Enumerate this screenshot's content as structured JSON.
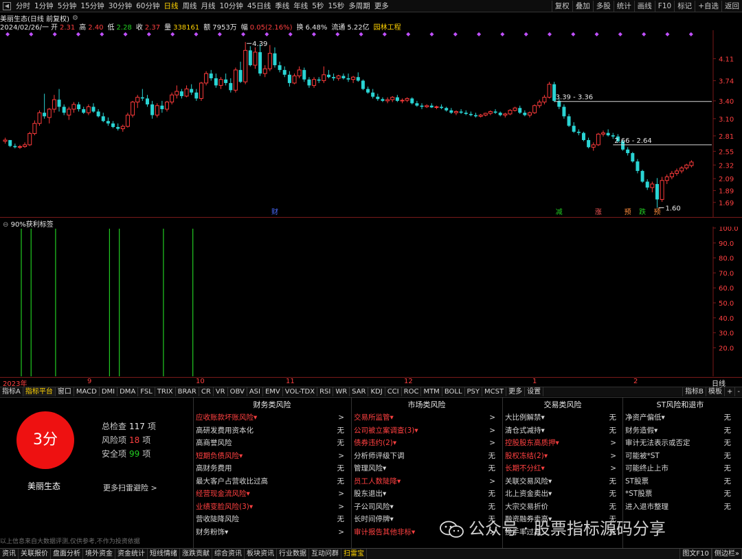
{
  "toolbar": {
    "periods": [
      "分时",
      "1分钟",
      "5分钟",
      "15分钟",
      "30分钟",
      "60分钟",
      "日线",
      "周线",
      "月线",
      "10分钟",
      "45日线",
      "季线",
      "年线",
      "5秒",
      "15秒",
      "多周期",
      "更多"
    ],
    "active_period": "日线",
    "right_buttons": [
      "复权",
      "叠加",
      "多股",
      "统计",
      "画线",
      "F10",
      "标记",
      "+自选",
      "返回"
    ]
  },
  "title": {
    "stock": "美丽生态(日线 前复权)",
    "date": "2024/02/26/一",
    "open_label": "开",
    "open": "2.31",
    "high_label": "高",
    "high": "2.40",
    "low_label": "低",
    "low": "2.28",
    "close_label": "收",
    "close": "2.37",
    "vol_label": "量",
    "volume": "338161",
    "amt_label": "额",
    "amount": "7953万",
    "chg_label": "幅",
    "change": "0.05(2.16%)",
    "turn_label": "换",
    "turnover": "6.48%",
    "float_label": "流通",
    "float_cap": "5.22亿",
    "sector": "园林工程"
  },
  "chart_data": {
    "type": "candlestick",
    "price_axis_ticks": [
      "4.11",
      "3.74",
      "3.40",
      "3.10",
      "2.81",
      "2.55",
      "2.32",
      "2.09",
      "1.89",
      "1.69"
    ],
    "ylim": [
      1.56,
      4.52
    ],
    "annotations": {
      "high_label": "4.39",
      "low_label": "1.60",
      "resistance_1": "3.39 - 3.36",
      "resistance_2": "2.66 - 2.64",
      "markers": [
        "财",
        "减",
        "涨",
        "预",
        "跌",
        "预"
      ]
    },
    "candles": [
      [
        2.72,
        2.78,
        2.68,
        2.74
      ],
      [
        2.74,
        2.74,
        2.62,
        2.64
      ],
      [
        2.64,
        2.68,
        2.6,
        2.62
      ],
      [
        2.63,
        2.66,
        2.59,
        2.63
      ],
      [
        2.63,
        2.7,
        2.61,
        2.66
      ],
      [
        2.66,
        2.88,
        2.64,
        2.85
      ],
      [
        2.85,
        3.07,
        2.82,
        3.02
      ],
      [
        3.02,
        3.24,
        2.98,
        3.2
      ],
      [
        3.2,
        3.52,
        3.1,
        3.14
      ],
      [
        3.12,
        3.28,
        3.02,
        3.26
      ],
      [
        3.26,
        3.5,
        3.2,
        3.42
      ],
      [
        3.42,
        3.6,
        3.22,
        3.3
      ],
      [
        3.3,
        3.34,
        3.16,
        3.2
      ],
      [
        3.16,
        3.3,
        3.08,
        3.26
      ],
      [
        3.26,
        3.38,
        3.2,
        3.34
      ],
      [
        3.34,
        3.38,
        3.22,
        3.26
      ],
      [
        3.26,
        3.3,
        3.18,
        3.2
      ],
      [
        3.2,
        3.34,
        3.16,
        3.3
      ],
      [
        3.3,
        3.36,
        3.2,
        3.22
      ],
      [
        3.22,
        3.26,
        3.12,
        3.14
      ],
      [
        3.14,
        3.2,
        3.04,
        3.06
      ],
      [
        3.06,
        3.12,
        2.98,
        3.02
      ],
      [
        3.02,
        3.06,
        2.94,
        2.96
      ],
      [
        2.96,
        3.02,
        2.9,
        2.93
      ],
      [
        2.93,
        3.0,
        2.88,
        2.97
      ],
      [
        2.97,
        3.2,
        2.95,
        3.16
      ],
      [
        3.16,
        3.4,
        3.12,
        3.38
      ],
      [
        3.38,
        3.5,
        3.28,
        3.46
      ],
      [
        3.46,
        3.6,
        3.4,
        3.44
      ],
      [
        3.44,
        3.5,
        3.3,
        3.34
      ],
      [
        3.34,
        3.4,
        3.1,
        3.16
      ],
      [
        3.16,
        3.36,
        3.12,
        3.32
      ],
      [
        3.32,
        3.4,
        3.2,
        3.26
      ],
      [
        3.26,
        3.4,
        3.22,
        3.38
      ],
      [
        3.38,
        3.54,
        3.34,
        3.5
      ],
      [
        3.5,
        3.66,
        3.44,
        3.56
      ],
      [
        3.56,
        3.6,
        3.44,
        3.48
      ],
      [
        3.48,
        3.66,
        3.46,
        3.6
      ],
      [
        3.6,
        3.68,
        3.5,
        3.54
      ],
      [
        3.54,
        3.6,
        3.4,
        3.44
      ],
      [
        3.44,
        3.72,
        3.4,
        3.7
      ],
      [
        3.7,
        3.9,
        3.66,
        3.86
      ],
      [
        3.86,
        3.92,
        3.74,
        3.78
      ],
      [
        3.78,
        3.86,
        3.62,
        3.66
      ],
      [
        3.66,
        3.8,
        3.6,
        3.76
      ],
      [
        3.76,
        3.86,
        3.66,
        3.7
      ],
      [
        3.7,
        3.78,
        3.54,
        3.58
      ],
      [
        3.58,
        3.96,
        3.54,
        3.92
      ],
      [
        3.92,
        4.06,
        3.7,
        3.72
      ],
      [
        3.72,
        4.39,
        3.68,
        4.25
      ],
      [
        4.25,
        4.32,
        3.98,
        4.0
      ],
      [
        4.0,
        4.3,
        3.94,
        4.22
      ],
      [
        4.22,
        4.36,
        3.82,
        3.86
      ],
      [
        3.86,
        4.0,
        3.8,
        3.94
      ],
      [
        3.94,
        4.34,
        3.9,
        4.2
      ],
      [
        4.2,
        4.3,
        3.96,
        4.0
      ],
      [
        4.0,
        4.06,
        3.88,
        3.92
      ],
      [
        3.92,
        3.98,
        3.8,
        3.84
      ],
      [
        3.84,
        3.9,
        3.64,
        3.7
      ],
      [
        3.7,
        3.86,
        3.68,
        3.82
      ],
      [
        3.82,
        3.98,
        3.78,
        3.92
      ],
      [
        3.92,
        3.96,
        3.72,
        3.76
      ],
      [
        3.76,
        3.8,
        3.62,
        3.66
      ],
      [
        3.66,
        3.8,
        3.62,
        3.76
      ],
      [
        3.76,
        3.8,
        3.7,
        3.74
      ],
      [
        3.74,
        3.98,
        3.7,
        3.84
      ],
      [
        3.84,
        3.92,
        3.78,
        3.8
      ],
      [
        3.8,
        3.86,
        3.74,
        3.78
      ],
      [
        3.78,
        3.84,
        3.74,
        3.82
      ],
      [
        3.82,
        3.86,
        3.76,
        3.78
      ],
      [
        3.78,
        3.86,
        3.72,
        3.76
      ],
      [
        3.76,
        3.82,
        3.7,
        3.8
      ],
      [
        3.8,
        3.88,
        3.72,
        3.74
      ],
      [
        3.74,
        3.76,
        3.58,
        3.6
      ],
      [
        3.6,
        3.64,
        3.52,
        3.54
      ],
      [
        3.54,
        3.6,
        3.44,
        3.47
      ],
      [
        3.47,
        3.52,
        3.4,
        3.43
      ],
      [
        3.43,
        3.46,
        3.38,
        3.4
      ],
      [
        3.4,
        3.46,
        3.36,
        3.42
      ],
      [
        3.42,
        3.48,
        3.38,
        3.46
      ],
      [
        3.46,
        3.5,
        3.38,
        3.4
      ],
      [
        3.4,
        3.44,
        3.36,
        3.41
      ],
      [
        3.41,
        3.46,
        3.38,
        3.44
      ],
      [
        3.44,
        3.46,
        3.34,
        3.36
      ],
      [
        3.36,
        3.4,
        3.3,
        3.32
      ],
      [
        3.32,
        3.36,
        3.26,
        3.3
      ],
      [
        3.3,
        3.34,
        3.28,
        3.32
      ],
      [
        3.32,
        3.36,
        3.28,
        3.29
      ],
      [
        3.29,
        3.32,
        3.26,
        3.3
      ],
      [
        3.3,
        3.34,
        3.26,
        3.28
      ],
      [
        3.28,
        3.3,
        3.22,
        3.24
      ],
      [
        3.24,
        3.28,
        3.18,
        3.2
      ],
      [
        3.2,
        3.24,
        3.16,
        3.22
      ],
      [
        3.22,
        3.26,
        3.18,
        3.2
      ],
      [
        3.2,
        3.24,
        3.16,
        3.18
      ],
      [
        3.18,
        3.22,
        3.14,
        3.16
      ],
      [
        3.16,
        3.2,
        3.12,
        3.14
      ],
      [
        3.14,
        3.18,
        3.12,
        3.16
      ],
      [
        3.16,
        3.2,
        3.14,
        3.19
      ],
      [
        3.19,
        3.24,
        3.16,
        3.22
      ],
      [
        3.22,
        3.26,
        3.18,
        3.2
      ],
      [
        3.2,
        3.22,
        3.14,
        3.16
      ],
      [
        3.16,
        3.2,
        3.12,
        3.18
      ],
      [
        3.18,
        3.26,
        3.16,
        3.24
      ],
      [
        3.24,
        3.3,
        3.22,
        3.28
      ],
      [
        3.28,
        3.32,
        3.18,
        3.2
      ],
      [
        3.2,
        3.24,
        3.14,
        3.16
      ],
      [
        3.16,
        3.22,
        3.12,
        3.2
      ],
      [
        3.2,
        3.34,
        3.18,
        3.32
      ],
      [
        3.32,
        3.42,
        3.28,
        3.38
      ],
      [
        3.38,
        3.5,
        3.34,
        3.46
      ],
      [
        3.46,
        3.72,
        3.44,
        3.68
      ],
      [
        3.68,
        3.72,
        3.38,
        3.4
      ],
      [
        3.4,
        3.44,
        3.26,
        3.3
      ],
      [
        3.3,
        3.34,
        3.1,
        3.14
      ],
      [
        3.14,
        3.18,
        2.96,
        2.98
      ],
      [
        2.98,
        3.04,
        2.86,
        2.88
      ],
      [
        2.88,
        2.92,
        2.82,
        2.86
      ],
      [
        2.86,
        2.88,
        2.72,
        2.74
      ],
      [
        2.74,
        2.78,
        2.6,
        2.62
      ],
      [
        2.62,
        2.7,
        2.56,
        2.66
      ],
      [
        2.66,
        2.86,
        2.64,
        2.84
      ],
      [
        2.84,
        2.9,
        2.8,
        2.86
      ],
      [
        2.86,
        2.92,
        2.8,
        2.82
      ],
      [
        2.82,
        2.86,
        2.76,
        2.8
      ],
      [
        2.8,
        2.84,
        2.7,
        2.72
      ],
      [
        2.72,
        2.74,
        2.56,
        2.58
      ],
      [
        2.58,
        2.62,
        2.48,
        2.52
      ],
      [
        2.52,
        2.54,
        2.36,
        2.38
      ],
      [
        2.38,
        2.42,
        2.18,
        2.22
      ],
      [
        2.22,
        2.24,
        2.02,
        2.04
      ],
      [
        2.04,
        2.08,
        1.9,
        1.94
      ],
      [
        1.94,
        2.04,
        1.86,
        2.0
      ],
      [
        2.0,
        2.1,
        1.6,
        1.74
      ],
      [
        1.74,
        2.12,
        1.7,
        2.06
      ],
      [
        2.06,
        2.16,
        2.0,
        2.12
      ],
      [
        2.12,
        2.22,
        2.08,
        2.18
      ],
      [
        2.18,
        2.26,
        2.14,
        2.22
      ],
      [
        2.22,
        2.3,
        2.18,
        2.27
      ],
      [
        2.27,
        2.34,
        2.24,
        2.32
      ],
      [
        2.31,
        2.4,
        2.28,
        2.37
      ]
    ],
    "subchart": {
      "title": "90%获利标签",
      "axis_ticks": [
        "100.0",
        "90.0",
        "80.0",
        "70.0",
        "60.0",
        "50.0",
        "40.0",
        "30.0",
        "20.0"
      ],
      "signal_indices": [
        3,
        5,
        10,
        21,
        23,
        32,
        38
      ]
    },
    "date_axis": [
      "2023年",
      "9",
      "10",
      "11",
      "12",
      "1",
      "2"
    ]
  },
  "date_axis_right": "日线",
  "tabs": {
    "items": [
      "指标A",
      "指标平台",
      "窗口",
      "MACD",
      "DMI",
      "DMA",
      "FSL",
      "TRIX",
      "BRAR",
      "CR",
      "VR",
      "OBV",
      "ASI",
      "EMV",
      "VOL-TDX",
      "RSI",
      "WR",
      "SAR",
      "KDJ",
      "CCI",
      "ROC",
      "MTM",
      "BOLL",
      "PSY",
      "MCST",
      "更多",
      "设置"
    ],
    "active": "指标平台",
    "right": [
      "指标B",
      "模板",
      "+",
      "-"
    ]
  },
  "scan": {
    "score": "3分",
    "stock_name": "美丽生态",
    "total_label": "总检查",
    "total": "117",
    "total_unit": "项",
    "risk_label": "风险项",
    "risk": "18",
    "risk_unit": "项",
    "safe_label": "安全项",
    "safe": "99",
    "safe_unit": "项",
    "more": "更多扫雷避险 >",
    "disclaimer": "以上信息来自大数据评测,仅供参考,不作为投资依据",
    "columns": [
      {
        "title": "财务类风险",
        "items": [
          {
            "label": "应收账款坏账风险▾",
            "value": ">",
            "risk": true
          },
          {
            "label": "高研发费用资本化",
            "value": "无",
            "risk": false
          },
          {
            "label": "高商誉风险",
            "value": "无",
            "risk": false
          },
          {
            "label": "短期负债风险▾",
            "value": ">",
            "risk": true
          },
          {
            "label": "高财务费用",
            "value": "无",
            "risk": false
          },
          {
            "label": "最大客户占营收比过高",
            "value": "无",
            "risk": false
          },
          {
            "label": "经营现金流风险▾",
            "value": ">",
            "risk": true
          },
          {
            "label": "业绩变脸风险(3)▾",
            "value": ">",
            "risk": true
          },
          {
            "label": "营收陡降风险",
            "value": "无",
            "risk": false
          },
          {
            "label": "财务粉饰▾",
            "value": ">",
            "risk": false
          }
        ]
      },
      {
        "title": "市场类风险",
        "items": [
          {
            "label": "交易所监管▾",
            "value": ">",
            "risk": true
          },
          {
            "label": "公司被立案调查(3)▾",
            "value": ">",
            "risk": true
          },
          {
            "label": "债券违约(2)▾",
            "value": ">",
            "risk": true
          },
          {
            "label": "分析师评级下调",
            "value": "无",
            "risk": false
          },
          {
            "label": "管理风险▾",
            "value": "无",
            "risk": false
          },
          {
            "label": "员工人数陡降▾",
            "value": ">",
            "risk": true
          },
          {
            "label": "股东退出▾",
            "value": "无",
            "risk": false
          },
          {
            "label": "子公司风险▾",
            "value": "无",
            "risk": false
          },
          {
            "label": "长时间停牌▾",
            "value": "无",
            "risk": false
          },
          {
            "label": "审计报告其他非标▾",
            "value": ">",
            "risk": true
          }
        ]
      },
      {
        "title": "交易类风险",
        "items": [
          {
            "label": "大比例解禁▾",
            "value": "无",
            "risk": false
          },
          {
            "label": "清仓式减持▾",
            "value": "无",
            "risk": false
          },
          {
            "label": "控股股东高质押▾",
            "value": ">",
            "risk": true
          },
          {
            "label": "股权冻结(2)▾",
            "value": ">",
            "risk": true
          },
          {
            "label": "长期不分红▾",
            "value": ">",
            "risk": true
          },
          {
            "label": "关联交易风险▾",
            "value": "无",
            "risk": false
          },
          {
            "label": "北上资金卖出▾",
            "value": "无",
            "risk": false
          },
          {
            "label": "大宗交易折价",
            "value": "无",
            "risk": false
          },
          {
            "label": "融资融券卖高▾",
            "value": "无",
            "risk": false
          },
          {
            "label": "换手率过高",
            "value": "无",
            "risk": false
          }
        ]
      },
      {
        "title": "ST风险和退市",
        "items": [
          {
            "label": "净资产偏低▾",
            "value": "无",
            "risk": false
          },
          {
            "label": "财务造假▾",
            "value": "无",
            "risk": false
          },
          {
            "label": "审计无法表示或否定",
            "value": "无",
            "risk": false
          },
          {
            "label": "可能被*ST",
            "value": "无",
            "risk": false
          },
          {
            "label": "可能终止上市",
            "value": "无",
            "risk": false
          },
          {
            "label": "ST股票",
            "value": "无",
            "risk": false
          },
          {
            "label": "*ST股票",
            "value": "无",
            "risk": false
          },
          {
            "label": "进入退市整理",
            "value": "无",
            "risk": false
          }
        ]
      }
    ]
  },
  "watermark": "公众号 · 股票指标源码分享",
  "bottombar": {
    "items": [
      "资讯",
      "关联报价",
      "盘面分析",
      "境外资金",
      "资金统计",
      "短线情绪",
      "涨跌贡献",
      "综合资讯",
      "板块资讯",
      "行业数据",
      "互动问群",
      "扫雷宝"
    ],
    "active": "扫雷宝",
    "right": [
      "图文F10",
      "侧边栏»"
    ]
  },
  "colors": {
    "up": "#ff3b3b",
    "down": "#2ad4d4",
    "signal": "#22cc22",
    "axis_text": "#ff4040",
    "risk": "#ff4040",
    "score_bg": "#ee1111"
  }
}
